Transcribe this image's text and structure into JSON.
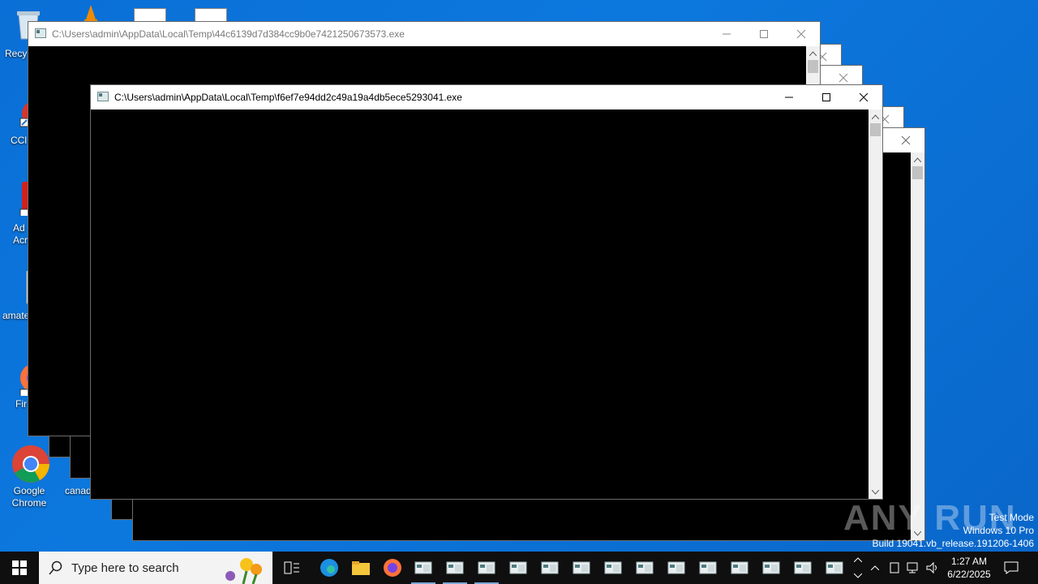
{
  "desktop": {
    "icons": [
      {
        "id": "recycle",
        "label": "Recy"
      },
      {
        "id": "ccleaner",
        "label": "CCl"
      },
      {
        "id": "acrobat",
        "label": "Ad\nAcr"
      },
      {
        "id": "amate",
        "label": "amate"
      },
      {
        "id": "firefox",
        "label": "Fir"
      },
      {
        "id": "chrome",
        "label": "Google Chrome"
      },
      {
        "id": "canad",
        "label": "canad"
      }
    ]
  },
  "windows": {
    "back_window": {
      "title": "C:\\Users\\admin\\AppData\\Local\\Temp\\44c6139d7d384cc9b0e7421250673573.exe"
    },
    "front_window": {
      "title": "C:\\Users\\admin\\AppData\\Local\\Temp\\f6ef7e94dd2c49a19a4db5ece5293041.exe"
    }
  },
  "taskbar": {
    "search_placeholder": "Type here to search",
    "clock_time": "1:27 AM",
    "clock_date": "6/22/2025"
  },
  "watermark": {
    "line1": "Test Mode",
    "line2": "Windows 10 Pro",
    "line3": "Build 19041.vb_release.191206-1406",
    "brand": "ANY RUN"
  },
  "colors": {
    "desktop": "#0a6fd6",
    "taskbar": "#0f0f0f",
    "console": "#000000"
  }
}
